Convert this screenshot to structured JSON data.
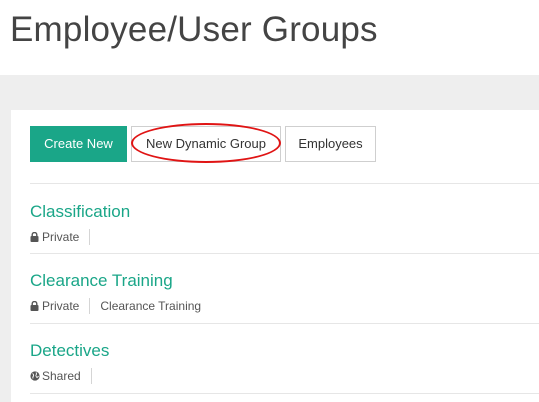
{
  "page": {
    "title": "Employee/User Groups"
  },
  "toolbar": {
    "create_new_label": "Create New",
    "new_dynamic_group_label": "New Dynamic Group",
    "employees_label": "Employees"
  },
  "groups": [
    {
      "name": "Classification",
      "visibility": "Private",
      "visibility_icon": "lock-icon",
      "tag": ""
    },
    {
      "name": "Clearance Training",
      "visibility": "Private",
      "visibility_icon": "lock-icon",
      "tag": "Clearance Training"
    },
    {
      "name": "Detectives",
      "visibility": "Shared",
      "visibility_icon": "globe-icon",
      "tag": ""
    }
  ],
  "colors": {
    "accent": "#1aa688",
    "annotation": "#e01414",
    "background_band": "#eeeeee"
  }
}
